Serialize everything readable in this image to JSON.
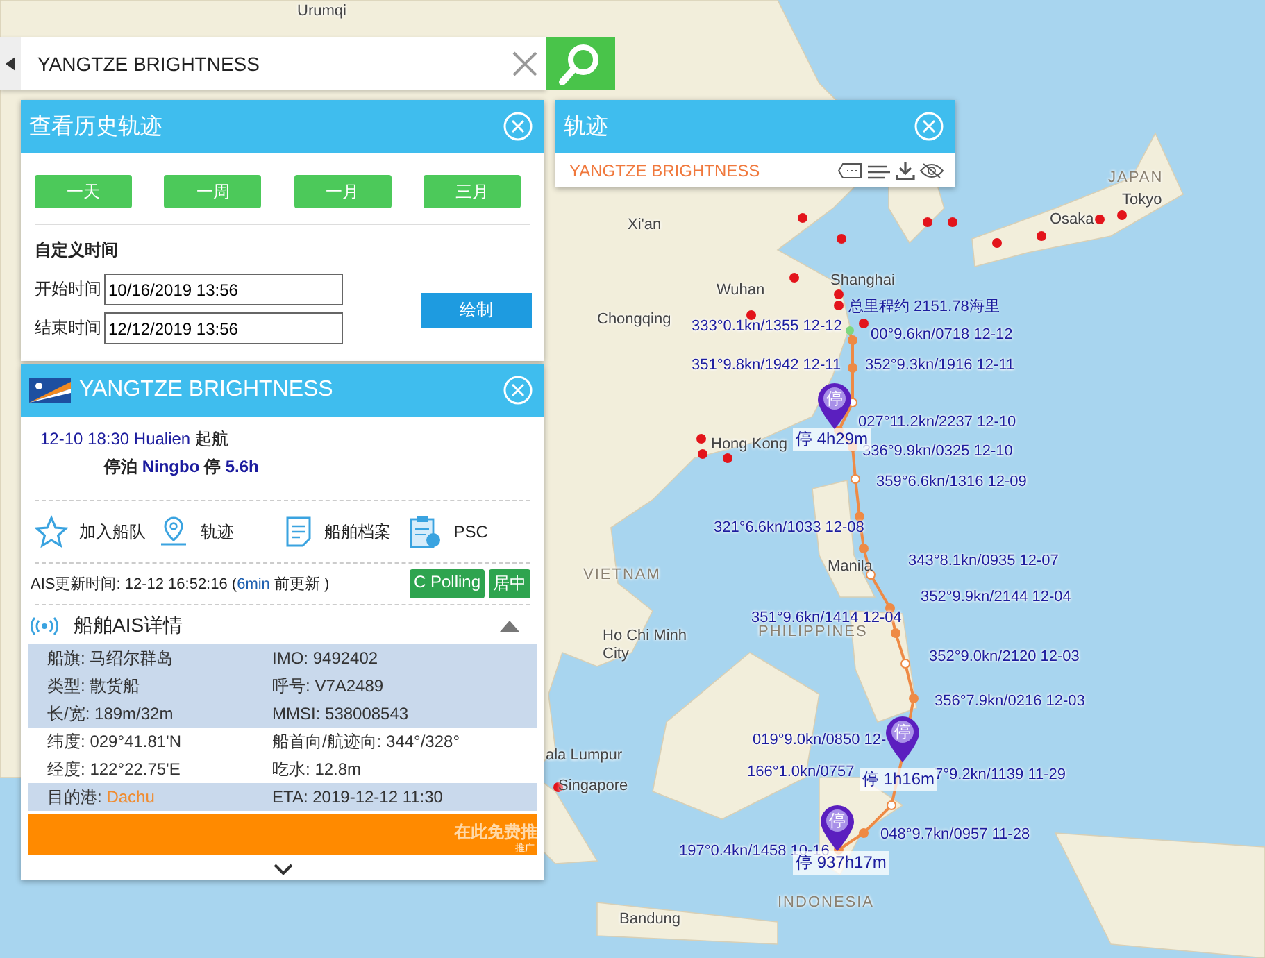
{
  "search": {
    "value": "YANGTZE BRIGHTNESS"
  },
  "history_panel": {
    "title": "查看历史轨迹",
    "ranges": [
      {
        "label": "一天"
      },
      {
        "label": "一周"
      },
      {
        "label": "一月"
      },
      {
        "label": "三月"
      }
    ],
    "custom_label": "自定义时间",
    "start": {
      "label": "开始时间",
      "value": "10/16/2019 13:56"
    },
    "end": {
      "label": "结束时间",
      "value": "12/12/2019 13:56"
    },
    "draw_button": "绘制"
  },
  "ship_panel": {
    "name": "YANGTZE BRIGHTNESS",
    "voyage": {
      "time": "12-10 18:30",
      "port": "Hualien",
      "status": "起航"
    },
    "berth": {
      "label": "停泊",
      "port": "Ningbo",
      "stop": "停",
      "duration": "5.6h"
    },
    "actions": [
      {
        "kind": "fleet",
        "label": "加入船队"
      },
      {
        "kind": "track",
        "label": "轨迹"
      },
      {
        "kind": "archive",
        "label": "船舶档案"
      },
      {
        "kind": "psc",
        "label": "PSC"
      }
    ],
    "ais_update": {
      "prefix": "AIS更新时间: 12-12 16:52:16 (",
      "ago": "6min",
      "suffix": " 前更新 )"
    },
    "tags": [
      "C Polling",
      "居中"
    ],
    "details": {
      "title": "船舶AIS详情",
      "expanded": true,
      "rows": [
        {
          "shaded": true,
          "cells": [
            {
              "label": "船旗:",
              "value": "马绍尔群岛",
              "highlighted": false
            },
            {
              "label": "IMO:",
              "value": "9492402",
              "highlighted": false
            }
          ]
        },
        {
          "shaded": true,
          "cells": [
            {
              "label": "类型:",
              "value": "散货船",
              "highlighted": false
            },
            {
              "label": "呼号:",
              "value": "V7A2489",
              "highlighted": false
            }
          ]
        },
        {
          "shaded": true,
          "cells": [
            {
              "label": "长/宽:",
              "value": "189m/32m",
              "highlighted": false
            },
            {
              "label": "MMSI:",
              "value": "538008543",
              "highlighted": false
            }
          ]
        },
        {
          "shaded": false,
          "cells": [
            {
              "label": "纬度:",
              "value": "029°41.81'N",
              "highlighted": false
            },
            {
              "label": "船首向/航迹向:",
              "value": "344°/328°",
              "highlighted": false
            }
          ]
        },
        {
          "shaded": false,
          "cells": [
            {
              "label": "经度:",
              "value": "122°22.75'E",
              "highlighted": false
            },
            {
              "label": "吃水:",
              "value": "12.8m",
              "highlighted": false
            }
          ]
        },
        {
          "shaded": true,
          "cells": [
            {
              "label": "目的港:",
              "value": "Dachu",
              "highlighted": true
            },
            {
              "label": "ETA:",
              "value": "2019-12-12 11:30",
              "highlighted": false
            }
          ]
        }
      ]
    },
    "ad_banner": {
      "text": "在此免费推",
      "note": "推广"
    }
  },
  "track_panel": {
    "title": "轨迹",
    "ship": "YANGTZE BRIGHTNESS"
  },
  "map": {
    "places": [
      {
        "kind": "city",
        "name": "Urumqi"
      },
      {
        "kind": "city",
        "name": "Xi'an"
      },
      {
        "kind": "city",
        "name": "Wuhan"
      },
      {
        "kind": "city",
        "name": "Shanghai"
      },
      {
        "kind": "city",
        "name": "Chongqing"
      },
      {
        "kind": "city",
        "name": "Hong Kong"
      },
      {
        "kind": "city",
        "name": "Manila"
      },
      {
        "kind": "country",
        "name": "VIETNAM"
      },
      {
        "kind": "country",
        "name": "PHILIPPINES"
      },
      {
        "kind": "city",
        "name": "Ho Chi Minh City"
      },
      {
        "kind": "city",
        "name": "ala Lumpur"
      },
      {
        "kind": "city",
        "name": "Singapore"
      },
      {
        "kind": "country",
        "name": "INDONESIA"
      },
      {
        "kind": "city",
        "name": "Bandung"
      },
      {
        "kind": "country",
        "name": "JAPAN"
      },
      {
        "kind": "city",
        "name": "Tokyo"
      },
      {
        "kind": "city",
        "name": "Osaka"
      }
    ],
    "total_distance": "总里程约 2151.78海里",
    "route_labels": [
      "333°0.1kn/1355 12-12",
      "00°9.6kn/0718 12-12",
      "351°9.8kn/1942 12-11",
      "352°9.3kn/1916 12-11",
      "027°11.2kn/2237 12-10",
      "336°9.9kn/0325 12-10",
      "359°6.6kn/1316 12-09",
      "321°6.6kn/1033 12-08",
      "343°8.1kn/0935 12-07",
      "352°9.9kn/2144 12-04",
      "351°9.6kn/1414 12-04",
      "352°9.0kn/2120 12-03",
      "356°7.9kn/0216 12-03",
      "019°9.0kn/0850 12-",
      "166°1.0kn/0757",
      "7°9.2kn/1139 11-29",
      "048°9.7kn/0957 11-28",
      "197°0.4kn/1458 10-16"
    ],
    "stops": [
      {
        "pin": "停",
        "label": "停 4h29m"
      },
      {
        "pin": "停",
        "label": "停 1h16m"
      },
      {
        "pin": "停",
        "label": "停 937h17m"
      }
    ]
  }
}
